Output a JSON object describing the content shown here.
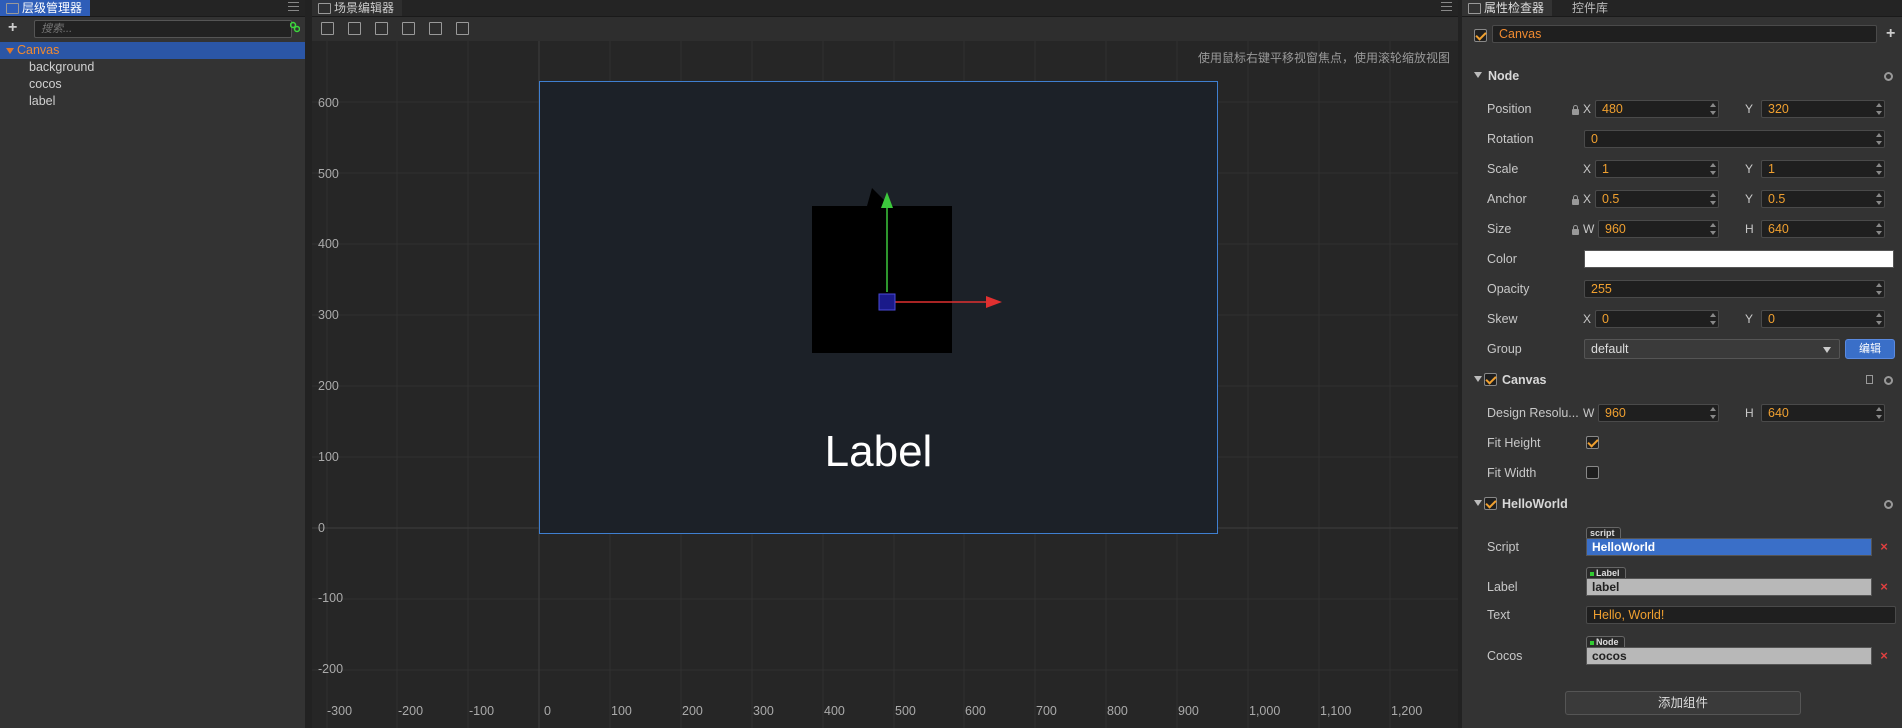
{
  "hierarchy": {
    "tab_label": "层级管理器",
    "search_placeholder": "搜索...",
    "nodes": [
      "Canvas",
      "background",
      "cocos",
      "label"
    ]
  },
  "scene": {
    "tab_label": "场景编辑器",
    "hint": "使用鼠标右键平移视窗焦点，使用滚轮缩放视图",
    "canvas_label": "Label",
    "y_ticks": [
      "600",
      "500",
      "400",
      "300",
      "200",
      "100",
      "0",
      "-100",
      "-200"
    ],
    "x_ticks": [
      "-300",
      "-200",
      "-100",
      "0",
      "100",
      "200",
      "300",
      "400",
      "500",
      "600",
      "700",
      "800",
      "900",
      "1,000",
      "1,100",
      "1,200"
    ]
  },
  "inspector": {
    "tab_active": "属性检查器",
    "tab_other": "控件库",
    "node_name": "Canvas",
    "node_section": "Node",
    "position": {
      "label": "Position",
      "x": "480",
      "y": "320"
    },
    "rotation": {
      "label": "Rotation",
      "value": "0"
    },
    "scale": {
      "label": "Scale",
      "x": "1",
      "y": "1"
    },
    "anchor": {
      "label": "Anchor",
      "x": "0.5",
      "y": "0.5"
    },
    "size": {
      "label": "Size",
      "w": "960",
      "h": "640"
    },
    "color": {
      "label": "Color",
      "value": "#ffffff"
    },
    "opacity": {
      "label": "Opacity",
      "value": "255"
    },
    "skew": {
      "label": "Skew",
      "x": "0",
      "y": "0"
    },
    "group": {
      "label": "Group",
      "value": "default",
      "edit": "编辑"
    },
    "axes": {
      "x": "X",
      "y": "Y",
      "w": "W",
      "h": "H"
    },
    "canvas_section": "Canvas",
    "design_resolution": {
      "label": "Design Resolu...",
      "w": "960",
      "h": "640"
    },
    "fit_height": {
      "label": "Fit Height",
      "checked": true
    },
    "fit_width": {
      "label": "Fit Width",
      "checked": false
    },
    "helloworld_section": "HelloWorld",
    "script": {
      "label": "Script",
      "tag": "script",
      "value": "HelloWorld"
    },
    "label_ref": {
      "label": "Label",
      "tag": "Label",
      "value": "label"
    },
    "text": {
      "label": "Text",
      "value": "Hello, World!"
    },
    "cocos_ref": {
      "label": "Cocos",
      "tag": "Node",
      "value": "cocos"
    },
    "add_component": "添加组件"
  },
  "colors": {
    "accent_blue": "#2b56a6",
    "value_orange": "#f0a030",
    "close_red": "#e04040"
  }
}
